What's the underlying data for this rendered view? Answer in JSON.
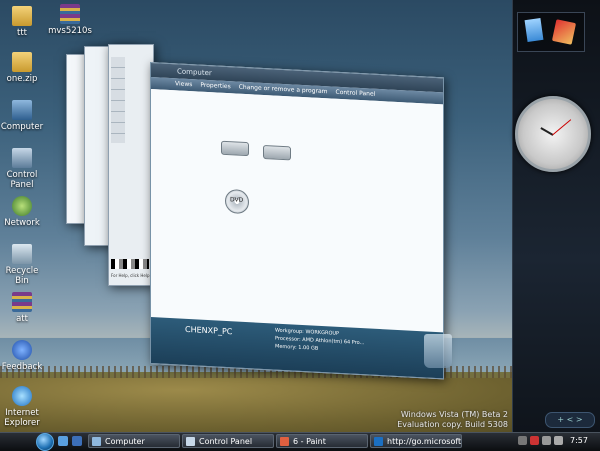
{
  "desktop_icons": [
    {
      "label": "ttt"
    },
    {
      "label": "mvs5210s"
    },
    {
      "label": "one.zip"
    },
    {
      "label": "Computer"
    },
    {
      "label": "Control Panel"
    },
    {
      "label": "Network"
    },
    {
      "label": "Recycle Bin"
    },
    {
      "label": "att"
    },
    {
      "label": "Feedback"
    },
    {
      "label": "Internet Explorer"
    }
  ],
  "computer_window": {
    "title": "Computer",
    "toolbar": [
      "Views",
      "Properties",
      "Change or remove a program",
      "Control Panel"
    ],
    "computer_name": "CHENXP_PC",
    "details": {
      "workgroup": "Workgroup: WORKGROUP",
      "processor": "Processor: AMD Athlon(tm) 64 Pro...",
      "memory": "Memory: 1.00 GB"
    },
    "dvd_label": "DVD"
  },
  "paint_window": {
    "status": "For Help, click Help Topics"
  },
  "watermark": {
    "line1": "Windows Vista (TM) Beta 2",
    "line2": "Evaluation copy. Build 5308"
  },
  "taskbar": {
    "buttons": [
      {
        "label": "Computer"
      },
      {
        "label": "Control Panel"
      },
      {
        "label": "6 - Paint"
      },
      {
        "label": "http://go.microsoft.c..."
      }
    ],
    "clock": "7:57"
  },
  "colors": {
    "accent": "#1d6fb3",
    "taskbar": "#0b0d10",
    "sidebar": "#1b2532"
  }
}
